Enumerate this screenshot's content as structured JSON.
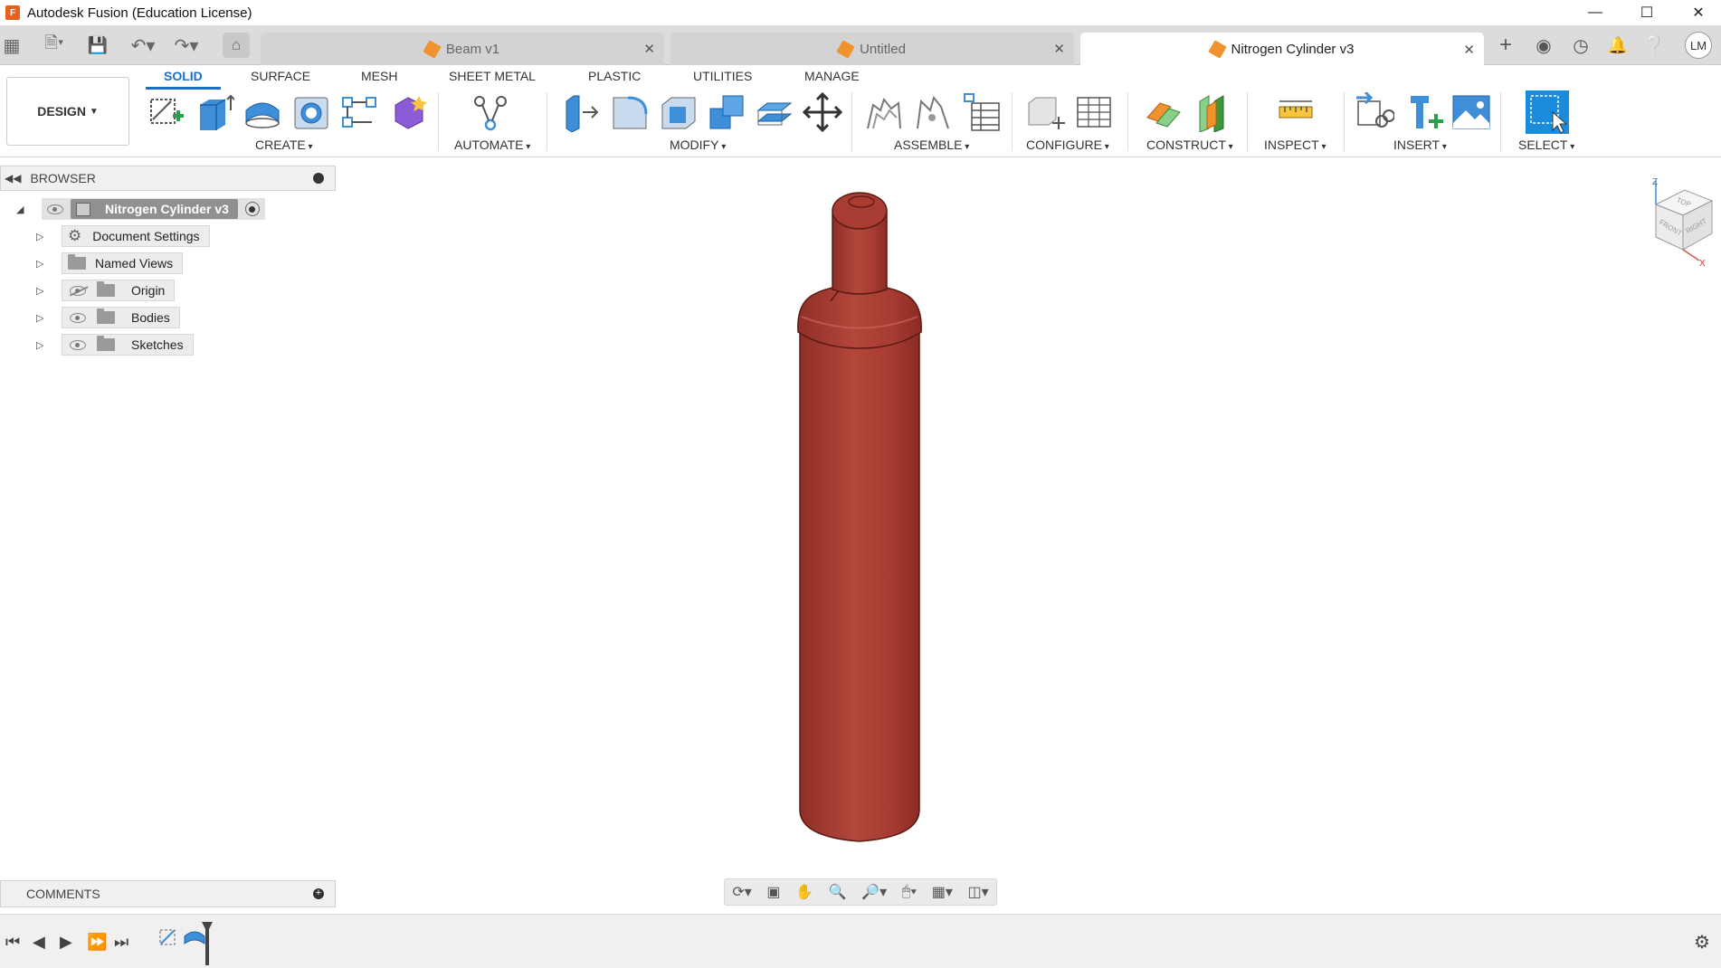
{
  "window": {
    "title": "Autodesk Fusion (Education License)",
    "app_badge": "F"
  },
  "tabs": [
    {
      "label": "Beam v1",
      "active": false
    },
    {
      "label": "Untitled",
      "active": false
    },
    {
      "label": "Nitrogen Cylinder v3",
      "active": true
    }
  ],
  "user": {
    "initials": "LM"
  },
  "workspace": {
    "label": "DESIGN"
  },
  "ribbon_tabs": [
    "SOLID",
    "SURFACE",
    "MESH",
    "SHEET METAL",
    "PLASTIC",
    "UTILITIES",
    "MANAGE"
  ],
  "groups": [
    "CREATE",
    "AUTOMATE",
    "MODIFY",
    "ASSEMBLE",
    "CONFIGURE",
    "CONSTRUCT",
    "INSPECT",
    "INSERT",
    "SELECT"
  ],
  "browser": {
    "title": "BROWSER",
    "root": "Nitrogen Cylinder v3",
    "items": [
      "Document Settings",
      "Named Views",
      "Origin",
      "Bodies",
      "Sketches"
    ]
  },
  "comments": {
    "title": "COMMENTS"
  },
  "viewcube": {
    "top": "TOP",
    "front": "FRONT",
    "right": "RIGHT",
    "z": "Z",
    "x": "X"
  },
  "colors": {
    "accent": "#1a6ecb",
    "model": "#a83c32",
    "doc_icon": "#f0922e"
  }
}
